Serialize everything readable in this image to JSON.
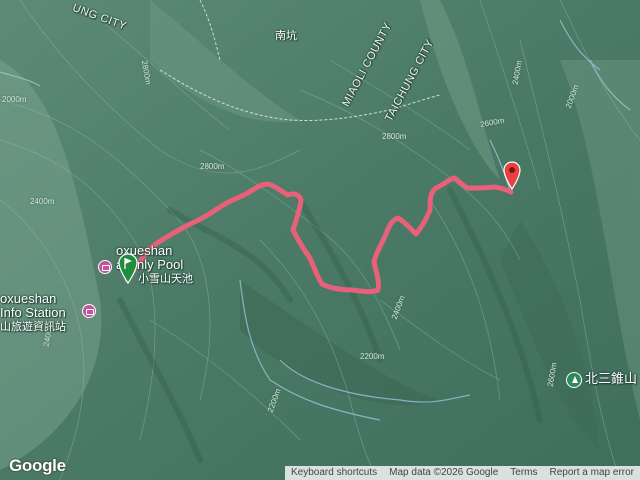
{
  "map": {
    "colors": {
      "terrain": "#4f7f6a",
      "track": "#e8607a",
      "start_marker": "#1e8e3e",
      "end_marker": "#e84040",
      "poi": "#c1549c",
      "park": "#2f8a5a"
    }
  },
  "labels": {
    "city_top": "UNG CITY",
    "nankeng": "南坑",
    "miaoli_county": "MIAOLI COUNTY",
    "taichung_city": "TAICHUNG CITY",
    "pool_name_line1": "oxueshan",
    "pool_name_line2": "avenly Pool",
    "pool_name_zh": "小雪山天池",
    "station_line1": "oxueshan",
    "station_line2": "Info Station",
    "station_zh": "山旅遊資訊站",
    "peak_zh": "北三錐山"
  },
  "contours": {
    "c2000_left": "2000m",
    "c2400_left": "2400m",
    "c2800_mid": "2800m",
    "c2800_right": "2800m",
    "c2400_right": "2400m",
    "c2600_right": "2600m",
    "c2400_center": "2400m",
    "c2200_center": "2200m",
    "c2200_bottom": "2200m",
    "c2600_bottom_right": "2600m",
    "c2000_topright": "2000m",
    "c2800_top": "2800m",
    "c2400_left2": "2400m"
  },
  "icons": {
    "start_marker": "flag-pin-icon",
    "end_marker": "map-pin-icon",
    "pool_poi": "camera-icon",
    "station_poi": "camera-icon",
    "peak_poi": "park-icon"
  },
  "footer": {
    "shortcuts": "Keyboard shortcuts",
    "mapdata": "Map data ©2026 Google",
    "terms": "Terms",
    "report": "Report a map error"
  },
  "logo": "Google"
}
